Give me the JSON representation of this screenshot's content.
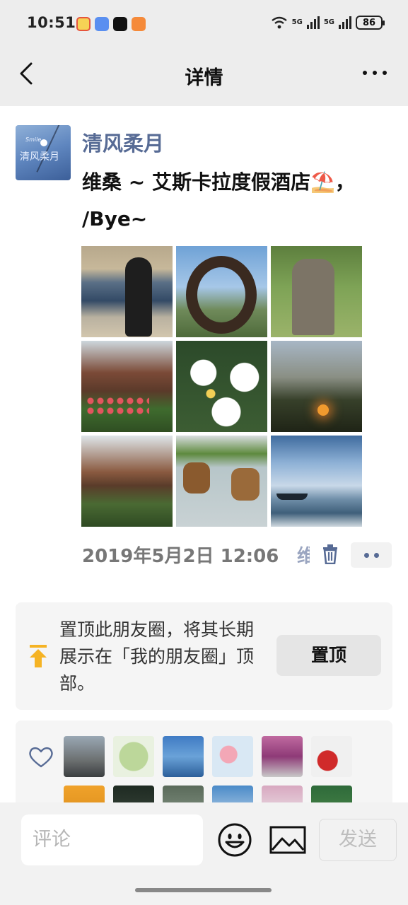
{
  "status_bar": {
    "time": "10:51",
    "network_1": "5G",
    "network_2": "5G",
    "battery": "86"
  },
  "nav": {
    "title": "详情",
    "back_icon": "chevron-left-icon",
    "more_icon": "more-dots-icon"
  },
  "post": {
    "username": "清风柔月",
    "avatar_text": "清风柔月",
    "avatar_badge": "Smile",
    "text_line1": "维桑 ~ 艾斯卡拉度假酒店⛱️，",
    "text_line2": "/Bye~",
    "photos": [
      "beach-person",
      "stone-ring-sculpture",
      "stone-statue",
      "tropical-house",
      "plumeria-flowers",
      "palm-sunset",
      "resort-garden",
      "dogs-in-water",
      "sea-boat"
    ],
    "timestamp": "2019年5月2日 12:06",
    "truncated_char": "维"
  },
  "pin": {
    "text": "置顶此朋友圈，将其长期展示在「我的朋友圈」顶部。",
    "button": "置顶"
  },
  "likes": {
    "icon": "heart-icon"
  },
  "comment_bar": {
    "placeholder": "评论",
    "send": "发送",
    "emoji_icon": "emoji-icon",
    "image_icon": "image-icon"
  },
  "colors": {
    "accent": "#576b95",
    "background": "#ededed",
    "card": "#f5f5f5"
  }
}
